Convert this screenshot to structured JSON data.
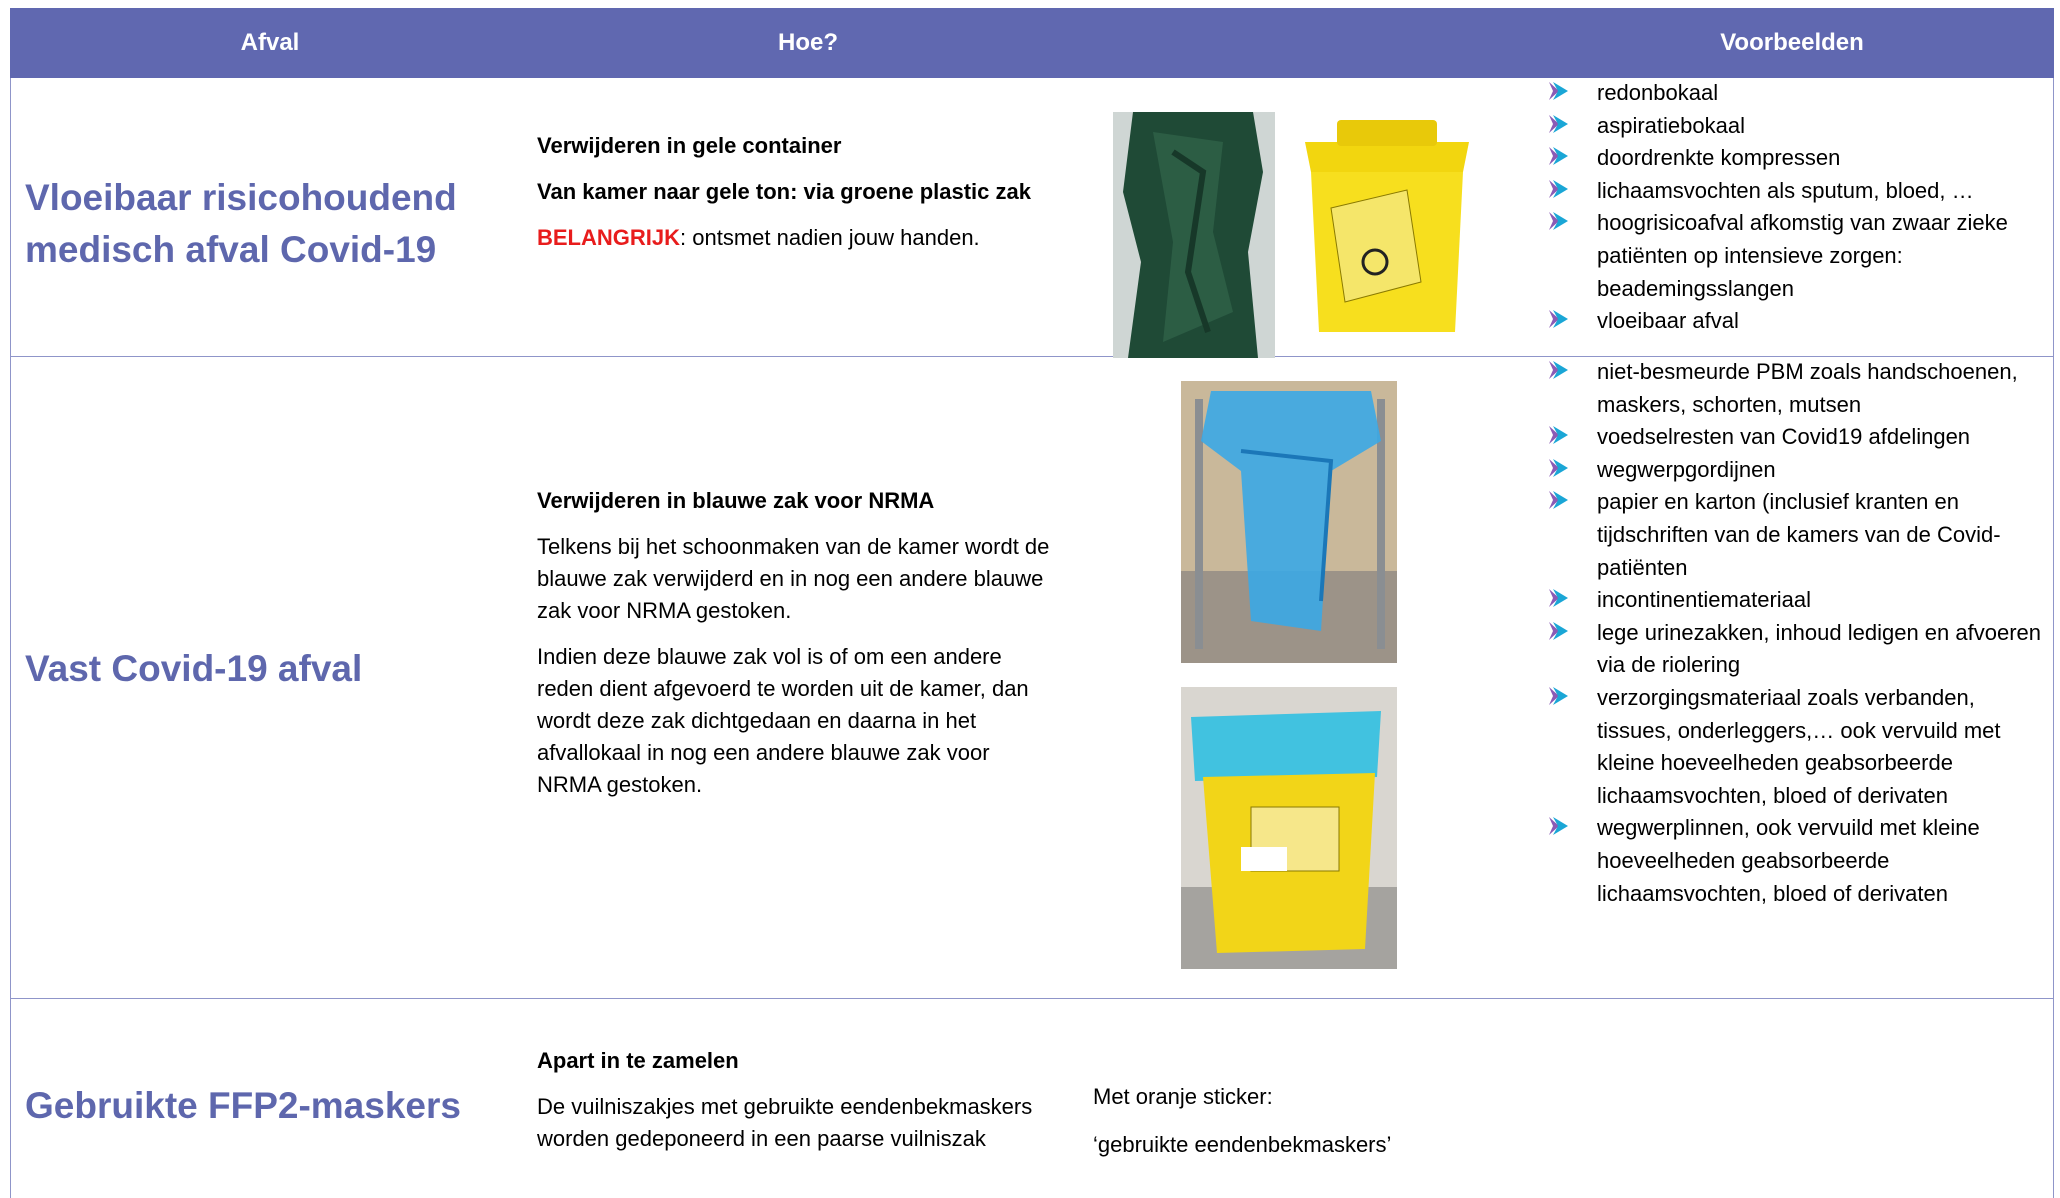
{
  "header": {
    "col1": "Afval",
    "col2": "Hoe?",
    "col3": "Voorbeelden"
  },
  "rows": [
    {
      "title": "Vloeibaar risicohoudend medisch afval Covid-19",
      "hoe": {
        "line1": "Verwijderen in gele container",
        "line2": "Van kamer naar gele ton: via groene plastic zak",
        "important_label": "BELANGRIJK",
        "important_text": ": ontsmet nadien jouw handen."
      },
      "examples": [
        "redonbokaal",
        "aspiratiebokaal",
        "doordrenkte kompressen",
        "lichaamsvochten als sputum, bloed, …",
        "hoogrisicoafval afkomstig van zwaar zieke patiënten op intensieve zorgen: beademingsslangen",
        "vloeibaar afval"
      ]
    },
    {
      "title": "Vast Covid-19 afval",
      "hoe": {
        "line1": "Verwijderen in blauwe zak voor NRMA",
        "para1": "Telkens bij het schoonmaken van de kamer wordt de blauwe zak verwijderd en in nog een andere blauwe zak voor NRMA gestoken.",
        "para2": "Indien deze blauwe zak vol is of om een andere reden dient afgevoerd te worden uit de kamer, dan wordt deze zak dichtgedaan en daarna in het afvallokaal in nog een andere blauwe zak voor NRMA gestoken."
      },
      "examples": [
        "niet-besmeurde PBM zoals handschoenen, maskers, schorten, mutsen",
        "voedselresten van Covid19 afdelingen",
        "wegwerpgordijnen",
        "papier en karton (inclusief kranten en tijdschriften van de kamers van de Covid-patiënten",
        "incontinentiemateriaal",
        "lege urinezakken, inhoud ledigen en afvoeren via de riolering",
        "verzorgingsmateriaal zoals verbanden, tissues, onderleggers,… ook vervuild met kleine hoeveelheden geabsorbeerde lichaamsvochten, bloed of derivaten",
        "wegwerplinnen, ook vervuild met kleine hoeveelheden geabsorbeerde lichaamsvochten, bloed of derivaten"
      ]
    },
    {
      "title": "Gebruikte FFP2-maskers",
      "hoe": {
        "line1": "Apart in te zamelen",
        "para1": "De vuilniszakjes met gebruikte eendenbekmaskers worden gedeponeerd in een paarse vuilniszak"
      },
      "note": {
        "line1": "Met oranje sticker:",
        "line2": "‘gebruikte eendenbekmaskers’"
      }
    }
  ],
  "icons": {
    "bullet": "arrow-bullet-icon"
  },
  "colors": {
    "header_bg": "#6068b0",
    "title": "#5e67ad",
    "important": "#e81c1c",
    "bullet_blue": "#1aa6d6",
    "bullet_purple": "#8b5bb5",
    "border": "#8f95c9"
  }
}
